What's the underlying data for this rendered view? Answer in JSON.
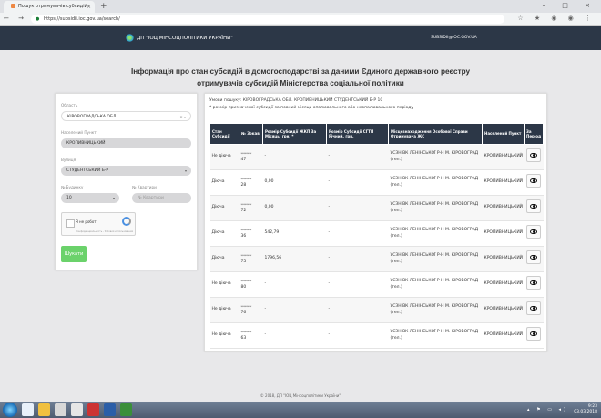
{
  "browser": {
    "tab_title": "Пошук отримувачів субсидій",
    "tab_close": "×",
    "new_tab": "+",
    "window_controls": "– □ ×",
    "nav": "← → C",
    "url": "https://subsidii.ioc.gov.ua/search/",
    "ext_icons": "☆ ★ ◉ ◉ ⋮"
  },
  "header": {
    "logo_text": "ДП \"ІОЦ МІНСОЦПОЛІТИКИ УКРАЇНИ\"",
    "email": "SUBSIDII@IOC.GOV.UA"
  },
  "title": "Інформація про стан субсидій в домогосподарстві за даними Єдиного державного реєстру отримувачів субсидій Міністерства соціальної політики",
  "filters": {
    "region_label": "Область",
    "region_value": "КІРОВОГРАДСЬКА ОБЛ.",
    "region_caret": "× ▾",
    "city_label": "Населений Пункт",
    "city_value": "КРОПИВНИЦЬКИЙ",
    "street_label": "Вулиця",
    "street_value": "СТУДЕНТСЬКИЙ Б-Р",
    "house_label": "№ Будинку",
    "house_value": "10",
    "apt_label": "№ Квартири",
    "apt_placeholder": "№ Квартири",
    "captcha_label": "Я не робот",
    "captcha_sub": "Конфиденциальность - Условия использования",
    "submit_label": "Шукати"
  },
  "results": {
    "query_line": "Умови пошуку: КІРОВОГРАДСЬКА ОБЛ. КРОПИВНИЦЬКИЙ СТУДЕНТСЬКИЙ Б-Р 10",
    "note_line": "* розмір призначеної субсидії за повний місяць опалювального або неопалювального періоду",
    "columns": [
      "Стан Субсидії",
      "№ Зокав",
      "Розмір Субсидії ЖКП За Місяць, грн. *",
      "Розмір Субсидії СГТП Річний, грн.",
      "Місцезнаходження Особової Справи Отримувача ЖС",
      "Населений Пункт",
      "За Період"
    ],
    "rows": [
      {
        "status": "Не діюча",
        "num_top": "********",
        "num": "47",
        "jkp": "-",
        "sgtp": "-",
        "location": "УСЗН ВК ЛЕНІНСЬКОЇ Р-Н М. КІРОВОГРАД (тел.)",
        "city": "КРОПИВНИЦЬКИЙ"
      },
      {
        "status": "Діюча",
        "num_top": "********",
        "num": "28",
        "jkp": "0,00",
        "sgtp": "-",
        "location": "УСЗН ВК ЛЕНІНСЬКОЇ Р-Н М. КІРОВОГРАД (тел.)",
        "city": "КРОПИВНИЦЬКИЙ"
      },
      {
        "status": "Діюча",
        "num_top": "********",
        "num": "72",
        "jkp": "0,00",
        "sgtp": "-",
        "location": "УСЗН ВК ЛЕНІНСЬКОЇ Р-Н М. КІРОВОГРАД (тел.)",
        "city": "КРОПИВНИЦЬКИЙ"
      },
      {
        "status": "Діюча",
        "num_top": "********",
        "num": "36",
        "jkp": "542,79",
        "sgtp": "-",
        "location": "УСЗН ВК ЛЕНІНСЬКОЇ Р-Н М. КІРОВОГРАД (тел.)",
        "city": "КРОПИВНИЦЬКИЙ"
      },
      {
        "status": "Діюча",
        "num_top": "********",
        "num": "75",
        "jkp": "1796,56",
        "sgtp": "-",
        "location": "УСЗН ВК ЛЕНІНСЬКОЇ Р-Н М. КІРОВОГРАД (тел.)",
        "city": "КРОПИВНИЦЬКИЙ"
      },
      {
        "status": "Не діюча",
        "num_top": "********",
        "num": "80",
        "jkp": "-",
        "sgtp": "-",
        "location": "УСЗН ВК ЛЕНІНСЬКОЇ Р-Н М. КІРОВОГРАД (тел.)",
        "city": "КРОПИВНИЦЬКИЙ"
      },
      {
        "status": "Не діюча",
        "num_top": "********",
        "num": "76",
        "jkp": "-",
        "sgtp": "-",
        "location": "УСЗН ВК ЛЕНІНСЬКОЇ Р-Н М. КІРОВОГРАД (тел.)",
        "city": "КРОПИВНИЦЬКИЙ"
      },
      {
        "status": "Не діюча",
        "num_top": "********",
        "num": "63",
        "jkp": "-",
        "sgtp": "-",
        "location": "УСЗН ВК ЛЕНІНСЬКОЇ Р-Н М. КІРОВОГРАД (тел.)",
        "city": "КРОПИВНИЦЬКИЙ"
      }
    ]
  },
  "footer": "© 2018, ДП \"ІОЦ Мінсоцполітики України\"",
  "taskbar": {
    "tray_icons": "▴ ⚑ ▭ ◂)",
    "time": "9:23",
    "date": "03.03.2018"
  }
}
